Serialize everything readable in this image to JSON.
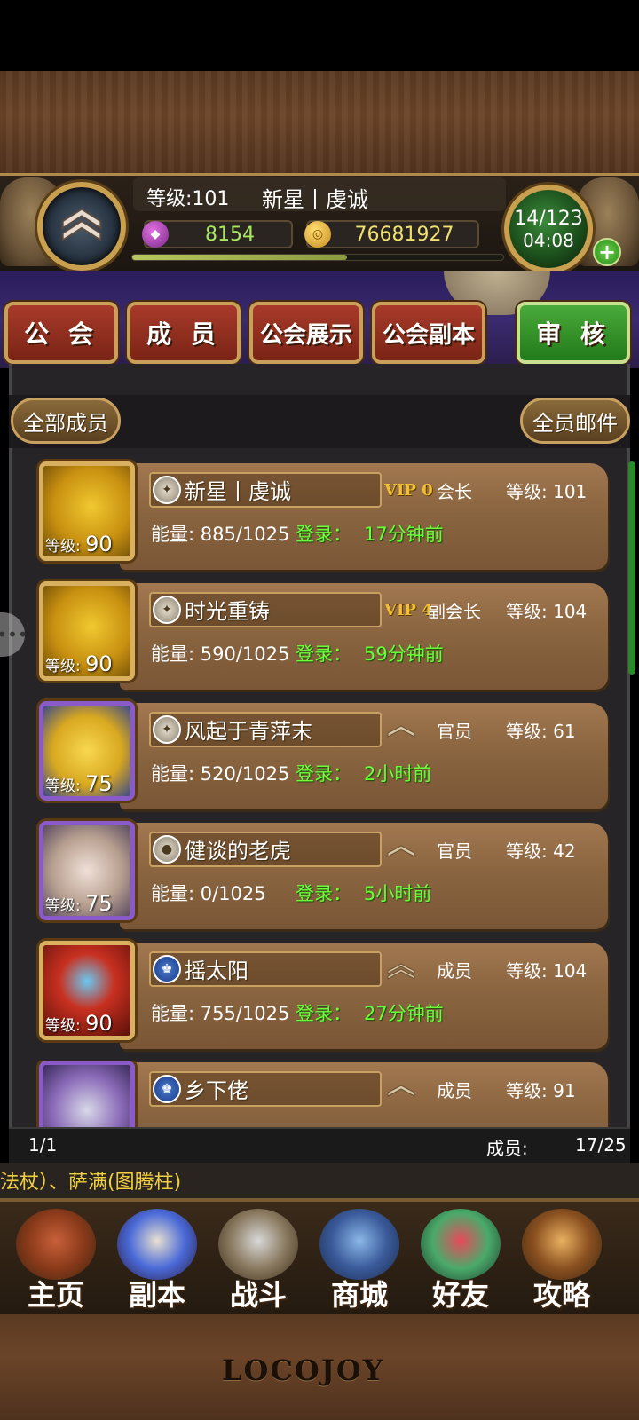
{
  "header": {
    "level_label": "等级:101",
    "player_name": "新星丨虔诚",
    "gems": "8154",
    "coins": "76681927",
    "stamina": "14/123",
    "timer": "04:08",
    "xp_progress": 0.58
  },
  "tabs": [
    {
      "label": "公 会"
    },
    {
      "label": "成 员"
    },
    {
      "label": "公会展示"
    },
    {
      "label": "公会副本"
    },
    {
      "label": "审 核"
    }
  ],
  "filter_button": "全部成员",
  "mail_button": "全员邮件",
  "members": [
    {
      "name": "新星丨虔诚",
      "badge": "VIP 0",
      "role": "会长",
      "level": "等级: 101",
      "avatar_level_prefix": "等级:",
      "avatar_level": "90",
      "energy": "能量: 885/1025",
      "login_label": "登录：",
      "login_time": "17分钟前"
    },
    {
      "name": "时光重铸",
      "badge": "VIP 4",
      "role": "副会长",
      "level": "等级: 104",
      "avatar_level_prefix": "等级:",
      "avatar_level": "90",
      "energy": "能量: 590/1025",
      "login_label": "登录：",
      "login_time": "59分钟前"
    },
    {
      "name": "风起于青萍末",
      "badge": "",
      "role": "官员",
      "level": "等级: 61",
      "avatar_level_prefix": "等级:",
      "avatar_level": "75",
      "energy": "能量: 520/1025",
      "login_label": "登录：",
      "login_time": "2小时前"
    },
    {
      "name": "健谈的老虎",
      "badge": "",
      "role": "官员",
      "level": "等级: 42",
      "avatar_level_prefix": "等级:",
      "avatar_level": "75",
      "energy": "能量: 0/1025",
      "login_label": "登录：",
      "login_time": "5小时前"
    },
    {
      "name": "摇太阳",
      "badge": "",
      "role": "成员",
      "level": "等级: 104",
      "avatar_level_prefix": "等级:",
      "avatar_level": "90",
      "energy": "能量: 755/1025",
      "login_label": "登录：",
      "login_time": "27分钟前"
    },
    {
      "name": "乡下佬",
      "badge": "",
      "role": "成员",
      "level": "等级: 91",
      "avatar_level_prefix": "",
      "avatar_level": "",
      "energy": "",
      "login_label": "",
      "login_time": ""
    }
  ],
  "footer": {
    "page": "1/1",
    "members_label": "成员:",
    "members_count": "17/25",
    "ticker": "法杖）、萨满(图腾柱)"
  },
  "nav": [
    {
      "label": "主页",
      "icon": "house-icon"
    },
    {
      "label": "副本",
      "icon": "skull-icon"
    },
    {
      "label": "战斗",
      "icon": "sword-icon"
    },
    {
      "label": "商城",
      "icon": "shop-icon"
    },
    {
      "label": "好友",
      "icon": "friends-icon"
    },
    {
      "label": "攻略",
      "icon": "book-icon"
    }
  ],
  "logo": "LOCOJOY",
  "colors": {
    "accent_green": "#6aff3a",
    "tab_red": "#a83a2a",
    "tab_active_green": "#4aaa3a",
    "vip_gold": "#f0c030"
  }
}
